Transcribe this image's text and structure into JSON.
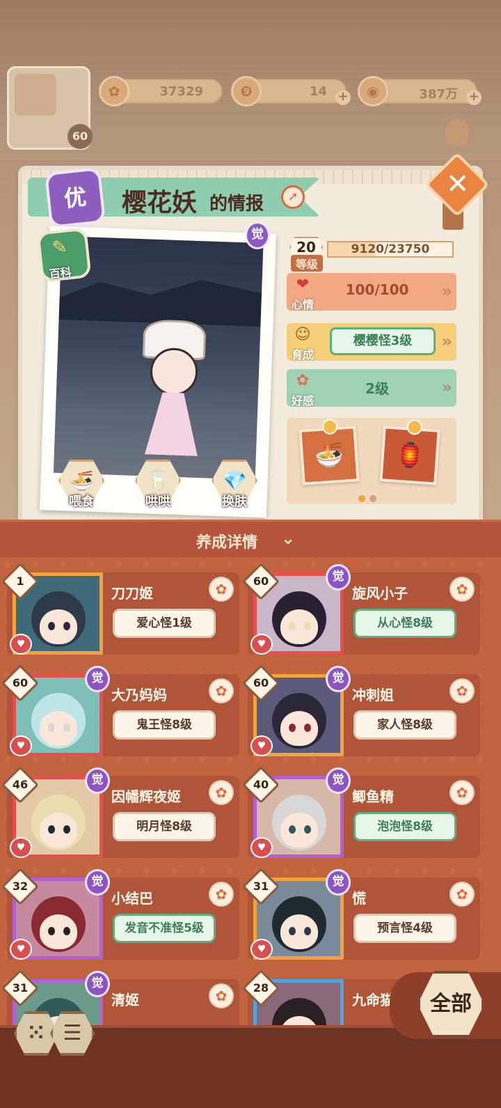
{
  "resources": [
    {
      "icon": "blossom-token-icon",
      "value": "37329",
      "has_plus": false
    },
    {
      "icon": "magatama-icon",
      "value": "14",
      "has_plus": true
    },
    {
      "icon": "coin-icon",
      "value": "387万",
      "has_plus": true
    }
  ],
  "player": {
    "level": "60"
  },
  "info": {
    "grade": "优",
    "name": "樱花妖",
    "title_suffix": "的情报",
    "awaken_label": "觉",
    "wiki_label": "百科",
    "level": "20",
    "level_label": "等级",
    "exp_text": "9120/23750",
    "exp_fraction": 0.384,
    "mood_label": "心情",
    "mood_value": "100/100",
    "grow_label": "育成",
    "grow_value": "樱樱怪3级",
    "favor_label": "好感",
    "favor_value": "2级",
    "actions": [
      {
        "label": "喂食",
        "icon": "noodle-bowl-icon"
      },
      {
        "label": "哄哄",
        "icon": "milk-carton-icon"
      },
      {
        "label": "换肤",
        "icon": "gem-icon"
      }
    ],
    "gift_page": 1,
    "gift_pages": 2
  },
  "details_label": "养成详情",
  "roster": [
    {
      "level": "1",
      "name": "刀刀姬",
      "pill": "爱心怪1级",
      "pill_green": false,
      "awakened": false,
      "frame": "#f4a23e"
    },
    {
      "level": "60",
      "name": "旋风小子",
      "pill": "从心怪8级",
      "pill_green": true,
      "awakened": true,
      "frame": "#e94e4e"
    },
    {
      "level": "60",
      "name": "大乃妈妈",
      "pill": "鬼王怪8级",
      "pill_green": false,
      "awakened": true,
      "frame": "#e94e4e"
    },
    {
      "level": "60",
      "name": "冲刺姐",
      "pill": "家人怪8级",
      "pill_green": false,
      "awakened": true,
      "frame": "#f4a23e"
    },
    {
      "level": "46",
      "name": "因幡辉夜姬",
      "pill": "明月怪8级",
      "pill_green": false,
      "awakened": true,
      "frame": "#e94e4e"
    },
    {
      "level": "40",
      "name": "鲫鱼精",
      "pill": "泡泡怪8级",
      "pill_green": true,
      "awakened": true,
      "frame": "#b15fd4"
    },
    {
      "level": "32",
      "name": "小结巴",
      "pill": "发音不准怪5级",
      "pill_green": true,
      "awakened": true,
      "frame": "#b15fd4"
    },
    {
      "level": "31",
      "name": "慌",
      "pill": "预言怪4级",
      "pill_green": false,
      "awakened": true,
      "frame": "#f4a23e"
    },
    {
      "level": "31",
      "name": "清姬",
      "pill": "",
      "pill_green": false,
      "awakened": true,
      "frame": "#b15fd4"
    },
    {
      "level": "28",
      "name": "九命猫",
      "pill": "",
      "pill_green": false,
      "awakened": false,
      "frame": "#4aa6e0"
    }
  ],
  "bottom": {
    "all_label": "全部"
  },
  "colors": {
    "accent": "#c2633f",
    "green": "#5fae7d",
    "purple": "#8d55c2"
  }
}
